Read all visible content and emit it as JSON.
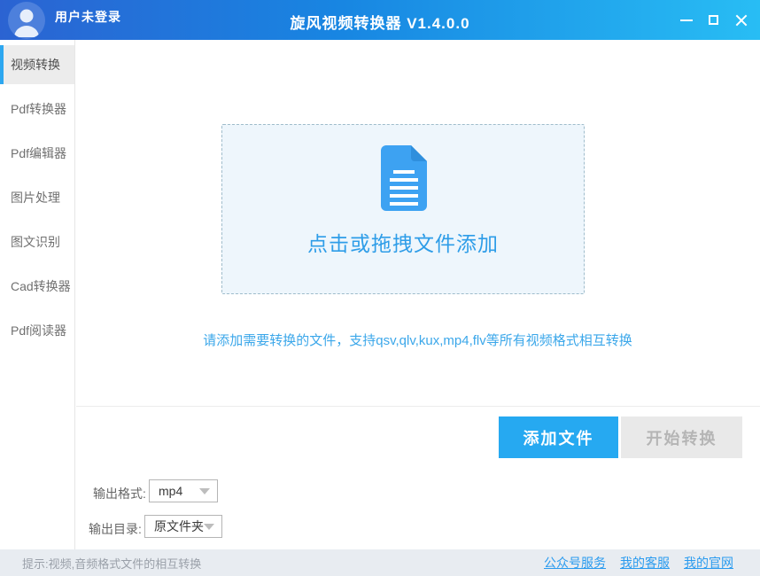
{
  "titlebar": {
    "user_status": "用户未登录",
    "title": "旋风视频转换器 V1.4.0.0",
    "icons": {
      "avatar": "user-silhouette",
      "minimize": "horizontal-bar",
      "maximize": "outlined-square",
      "close": "x-cross"
    },
    "colors": {
      "gradient_left": "#2b63d2",
      "gradient_right": "#28bdf4"
    }
  },
  "sidebar": {
    "items": [
      {
        "label": "视频转换",
        "active": true
      },
      {
        "label": "Pdf转换器",
        "active": false
      },
      {
        "label": "Pdf编辑器",
        "active": false
      },
      {
        "label": "图片处理",
        "active": false
      },
      {
        "label": "图文识别",
        "active": false
      },
      {
        "label": "Cad转换器",
        "active": false
      },
      {
        "label": "Pdf阅读器",
        "active": false
      }
    ],
    "active_accent_color": "#2da7f0"
  },
  "dropzone": {
    "text": "点击或拖拽文件添加",
    "icon": "document-file",
    "background": "#eef6fc",
    "border_color": "#9fbccb",
    "text_color": "#2e9de8"
  },
  "hint": "请添加需要转换的文件，支持qsv,qlv,kux,mp4,flv等所有视频格式相互转换",
  "actions": {
    "add_label": "添加文件",
    "start_label": "开始转换",
    "add_color": "#26a9f1",
    "start_disabled": true
  },
  "output": {
    "format_label": "输出格式:",
    "format_value": "mp4",
    "dir_label": "输出目录:",
    "dir_value": "原文件夹"
  },
  "statusbar": {
    "tip": "提示:视频,音频格式文件的相互转换",
    "links": [
      "公众号服务",
      "我的客服",
      "我的官网"
    ]
  }
}
